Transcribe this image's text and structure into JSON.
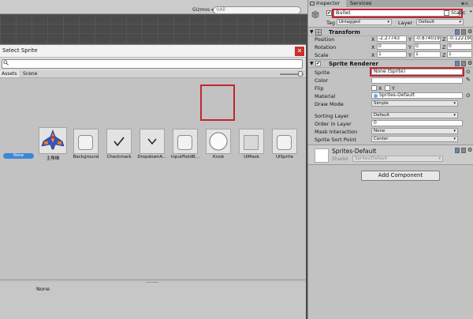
{
  "scene": {
    "gizmos_label": "Gizmos",
    "search_placeholder": "All"
  },
  "sprite_picker": {
    "title": "Select Sprite",
    "search_value": "",
    "tabs": [
      "Assets",
      "Scene"
    ],
    "items": [
      {
        "label": "None",
        "kind": "none",
        "selected": true
      },
      {
        "label": "主角機",
        "kind": "spaceship"
      },
      {
        "label": "Background",
        "kind": "rounded-square"
      },
      {
        "label": "Checkmark",
        "kind": "checkmark"
      },
      {
        "label": "DropdownA…",
        "kind": "chevron"
      },
      {
        "label": "InputFieldB…",
        "kind": "rounded-square"
      },
      {
        "label": "Knob",
        "kind": "circle",
        "highlighted": true
      },
      {
        "label": "UIMask",
        "kind": "square"
      },
      {
        "label": "UISprite",
        "kind": "rounded-square"
      }
    ],
    "preview_name": "None"
  },
  "inspector": {
    "tabs": [
      "Inspector",
      "Services"
    ],
    "gameobject": {
      "active": true,
      "name": "Bullet",
      "static_label": "Static",
      "tag_label": "Tag",
      "tag_value": "Untagged",
      "layer_label": "Layer",
      "layer_value": "Default"
    },
    "transform": {
      "title": "Transform",
      "position": {
        "label": "Position",
        "x": "-2.27743",
        "y": "-0.874019",
        "z": "-0.122190"
      },
      "rotation": {
        "label": "Rotation",
        "x": "0",
        "y": "0",
        "z": "0"
      },
      "scale": {
        "label": "Scale",
        "x": "1",
        "y": "1",
        "z": "1"
      }
    },
    "sprite_renderer": {
      "title": "Sprite Renderer",
      "sprite_label": "Sprite",
      "sprite_value": "None (Sprite)",
      "color_label": "Color",
      "flip_label": "Flip",
      "flip_x": "X",
      "flip_y": "Y",
      "material_label": "Material",
      "material_value": "Sprites-Default",
      "draw_mode_label": "Draw Mode",
      "draw_mode_value": "Simple",
      "sorting_layer_label": "Sorting Layer",
      "sorting_layer_value": "Default",
      "order_label": "Order in Layer",
      "order_value": "0",
      "mask_label": "Mask Interaction",
      "mask_value": "None",
      "sort_point_label": "Sprite Sort Point",
      "sort_point_value": "Center"
    },
    "material": {
      "name": "Sprites-Default",
      "shader_label": "Shader",
      "shader_value": "Sprites/Default"
    },
    "add_component_label": "Add Component"
  },
  "colors": {
    "highlight": "#c22630",
    "selection": "#3d86d6"
  }
}
